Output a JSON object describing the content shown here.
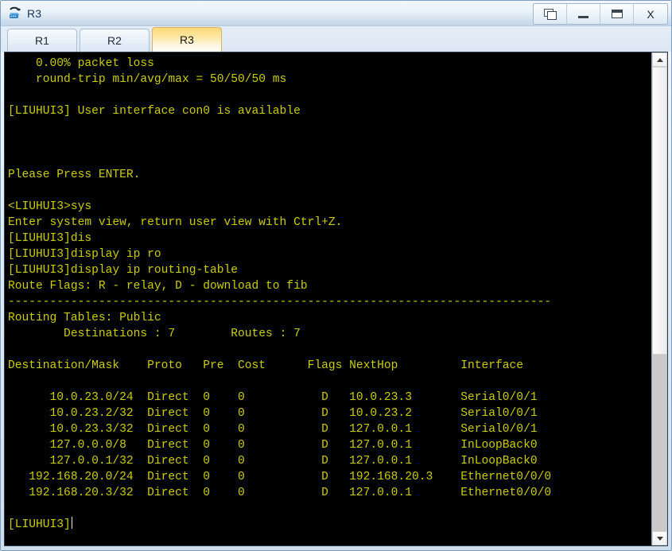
{
  "window": {
    "title": "R3",
    "icon": "router-icon",
    "buttons": [
      {
        "name": "restore-button",
        "glyph": "restore-icon",
        "label": ""
      },
      {
        "name": "minimize-button",
        "glyph": "minimize-icon",
        "label": ""
      },
      {
        "name": "maximize-button",
        "glyph": "maximize-icon",
        "label": ""
      },
      {
        "name": "close-button",
        "glyph": "close-icon",
        "label": "X"
      }
    ]
  },
  "tabs": [
    {
      "label": "R1",
      "active": false
    },
    {
      "label": "R2",
      "active": false
    },
    {
      "label": "R3",
      "active": true
    }
  ],
  "terminal": {
    "foreground": "#cccc00",
    "background": "#000000",
    "prompt_system": "[LIUHUI3]",
    "prompt_user": "<LIUHUI3>",
    "cursor_visible": true,
    "lines": [
      "    0.00% packet loss",
      "    round-trip min/avg/max = 50/50/50 ms",
      "",
      "[LIUHUI3] User interface con0 is available",
      "",
      "",
      "",
      "Please Press ENTER.",
      "",
      "<LIUHUI3>sys",
      "Enter system view, return user view with Ctrl+Z.",
      "[LIUHUI3]dis",
      "[LIUHUI3]display ip ro",
      "[LIUHUI3]display ip routing-table",
      "Route Flags: R - relay, D - download to fib",
      "------------------------------------------------------------------------------",
      "Routing Tables: Public",
      "        Destinations : 7        Routes : 7",
      "",
      "Destination/Mask    Proto   Pre  Cost      Flags NextHop         Interface",
      "",
      "      10.0.23.0/24  Direct  0    0           D   10.0.23.3       Serial0/0/1",
      "      10.0.23.2/32  Direct  0    0           D   10.0.23.2       Serial0/0/1",
      "      10.0.23.3/32  Direct  0    0           D   127.0.0.1       Serial0/0/1",
      "      127.0.0.0/8   Direct  0    0           D   127.0.0.1       InLoopBack0",
      "      127.0.0.1/32  Direct  0    0           D   127.0.0.1       InLoopBack0",
      "   192.168.20.0/24  Direct  0    0           D   192.168.20.3    Ethernet0/0/0",
      "   192.168.20.3/32  Direct  0    0           D   127.0.0.1       Ethernet0/0/0",
      "",
      "[LIUHUI3]"
    ],
    "routing_table": {
      "flags_legend": "Route Flags: R - relay, D - download to fib",
      "table_name": "Routing Tables: Public",
      "destinations": "7",
      "routes": "7",
      "headers": [
        "Destination/Mask",
        "Proto",
        "Pre",
        "Cost",
        "Flags",
        "NextHop",
        "Interface"
      ],
      "rows": [
        [
          "10.0.23.0/24",
          "Direct",
          "0",
          "0",
          "D",
          "10.0.23.3",
          "Serial0/0/1"
        ],
        [
          "10.0.23.2/32",
          "Direct",
          "0",
          "0",
          "D",
          "10.0.23.2",
          "Serial0/0/1"
        ],
        [
          "10.0.23.3/32",
          "Direct",
          "0",
          "0",
          "D",
          "127.0.0.1",
          "Serial0/0/1"
        ],
        [
          "127.0.0.0/8",
          "Direct",
          "0",
          "0",
          "D",
          "127.0.0.1",
          "InLoopBack0"
        ],
        [
          "127.0.0.1/32",
          "Direct",
          "0",
          "0",
          "D",
          "127.0.0.1",
          "InLoopBack0"
        ],
        [
          "192.168.20.0/24",
          "Direct",
          "0",
          "0",
          "D",
          "192.168.20.3",
          "Ethernet0/0/0"
        ],
        [
          "192.168.20.3/32",
          "Direct",
          "0",
          "0",
          "D",
          "127.0.0.1",
          "Ethernet0/0/0"
        ]
      ]
    }
  },
  "scrollbar": {
    "up_arrow": "chevron-up-icon",
    "down_arrow": "chevron-down-icon",
    "thumb_top_percent": 0,
    "thumb_height_percent": 62
  }
}
